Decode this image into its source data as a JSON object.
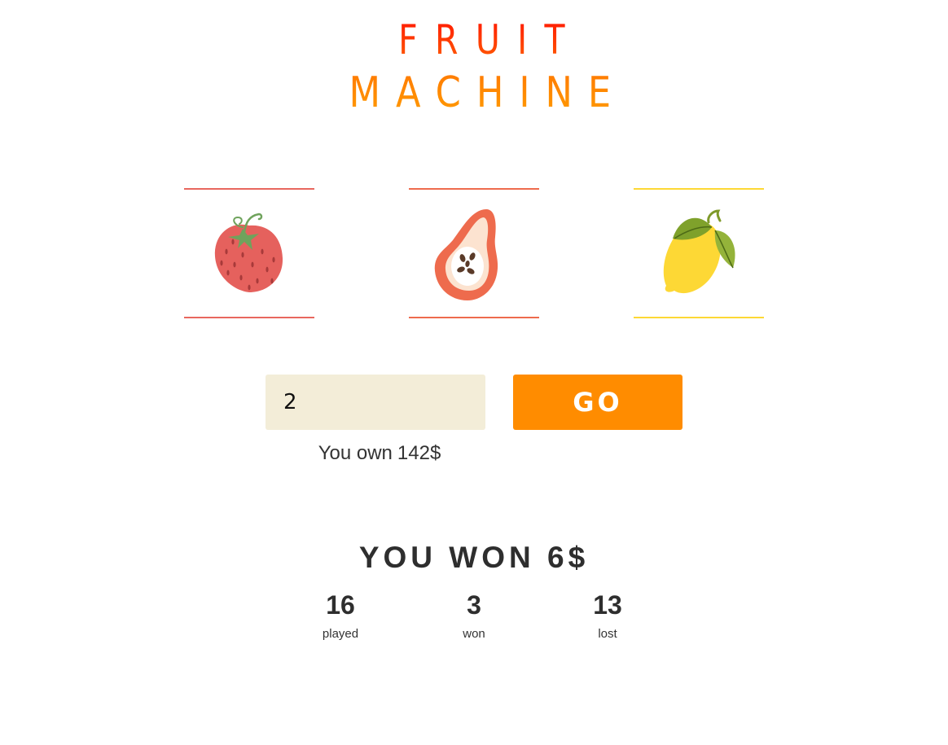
{
  "title": {
    "line1": "FRUIT",
    "line2": "MACHINE"
  },
  "reels": [
    {
      "fruit": "strawberry-icon",
      "color": "#e8675e"
    },
    {
      "fruit": "papaya-icon",
      "color": "#ee6b4d"
    },
    {
      "fruit": "lemon-icon",
      "color": "#fdd835"
    }
  ],
  "bet": {
    "value": "2"
  },
  "go_button": {
    "label": "GO",
    "color": "#ff8c00"
  },
  "balance": {
    "label": "You own",
    "amount": "142$"
  },
  "result": {
    "text": "YOU WON 6$"
  },
  "stats": {
    "played": {
      "value": "16",
      "label": "played"
    },
    "won": {
      "value": "3",
      "label": "won"
    },
    "lost": {
      "value": "13",
      "label": "lost"
    }
  },
  "colors": {
    "title_top": "#ff1a00",
    "title_bottom": "#ff9a00",
    "input_bg": "#f3edd8"
  }
}
